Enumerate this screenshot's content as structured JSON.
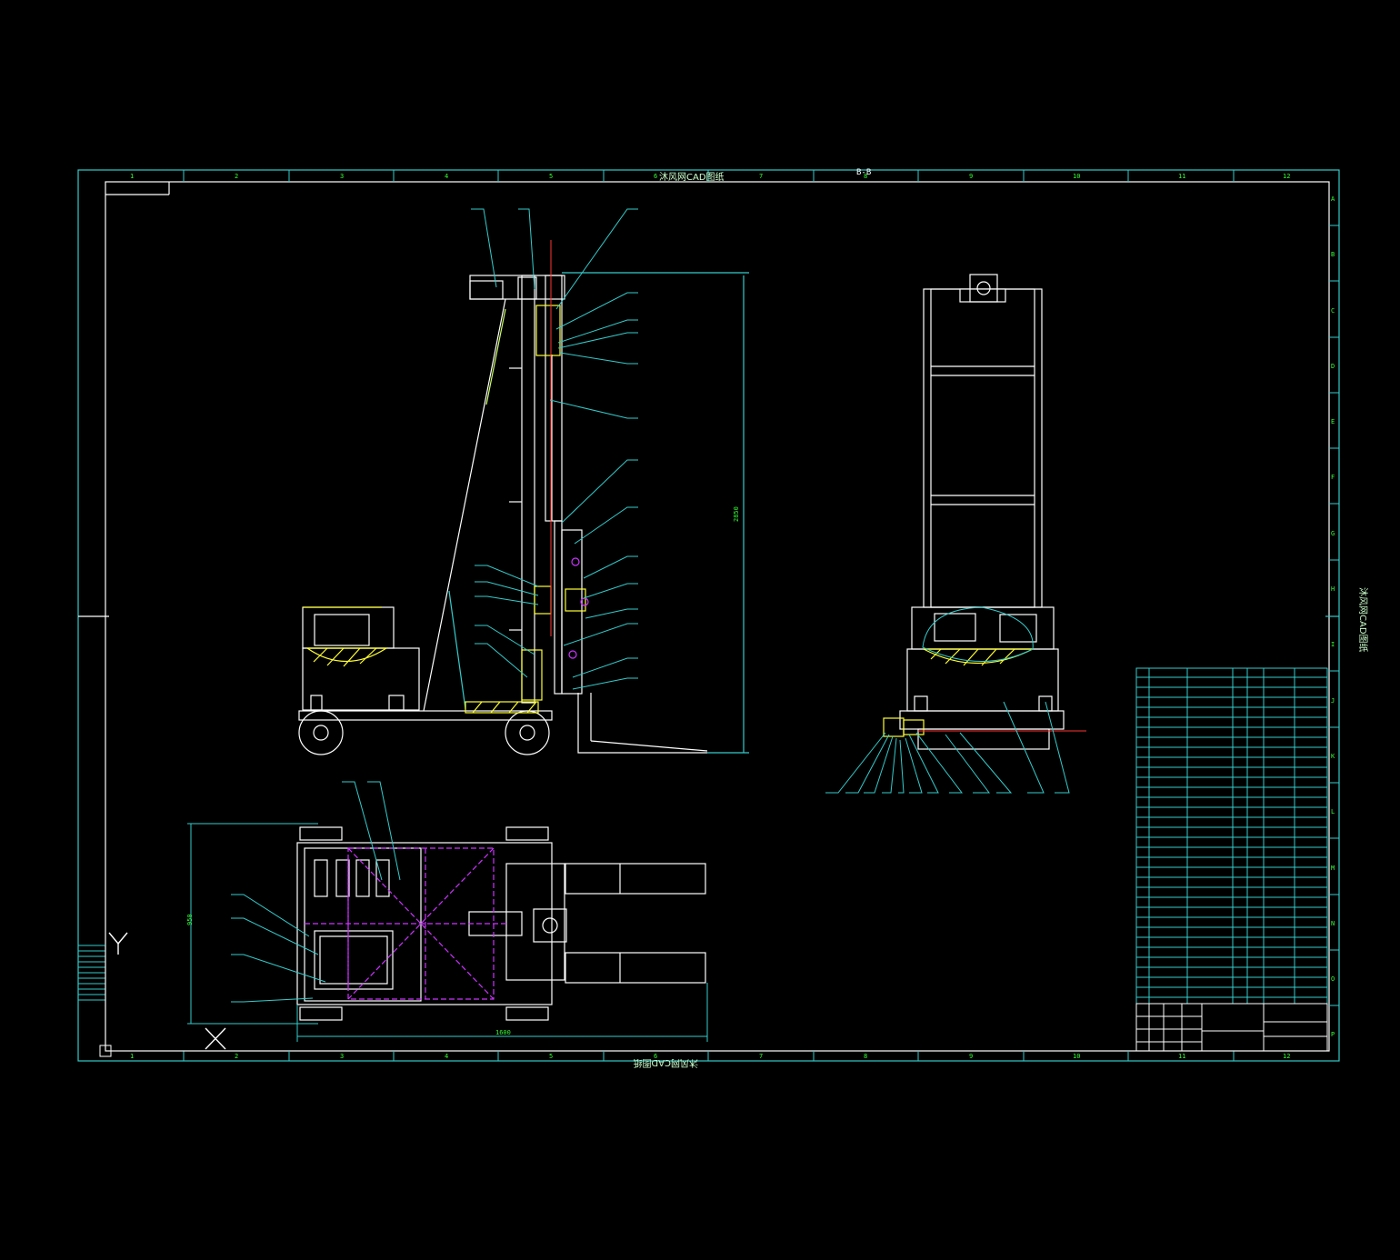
{
  "colors": {
    "background": "#000000",
    "frame": "#33cccc",
    "geometry": "#ffffff",
    "hatch": "#ffff33",
    "centerline": "#ff3333",
    "hidden": "#cc33ff",
    "text": "#33ff33"
  },
  "watermark_top": "沐风网CAD图纸",
  "watermark_bottom": "沐风网CAD图纸",
  "watermark_right": "沐风网CAD图纸",
  "section_label": "B-B",
  "column_numbers": [
    "1",
    "2",
    "3",
    "4",
    "5",
    "6",
    "7",
    "8",
    "9",
    "10",
    "11",
    "12"
  ],
  "row_letters": [
    "A",
    "B",
    "C",
    "D",
    "E",
    "F",
    "G",
    "H",
    "I",
    "J",
    "K",
    "L",
    "M",
    "N",
    "O",
    "P"
  ],
  "dimensions": {
    "height": "2850",
    "plan_width": "950",
    "plan_length": "1600"
  },
  "ucs": {
    "x_label": "X",
    "y_label": "Y",
    "icon": "ucs-icon"
  }
}
